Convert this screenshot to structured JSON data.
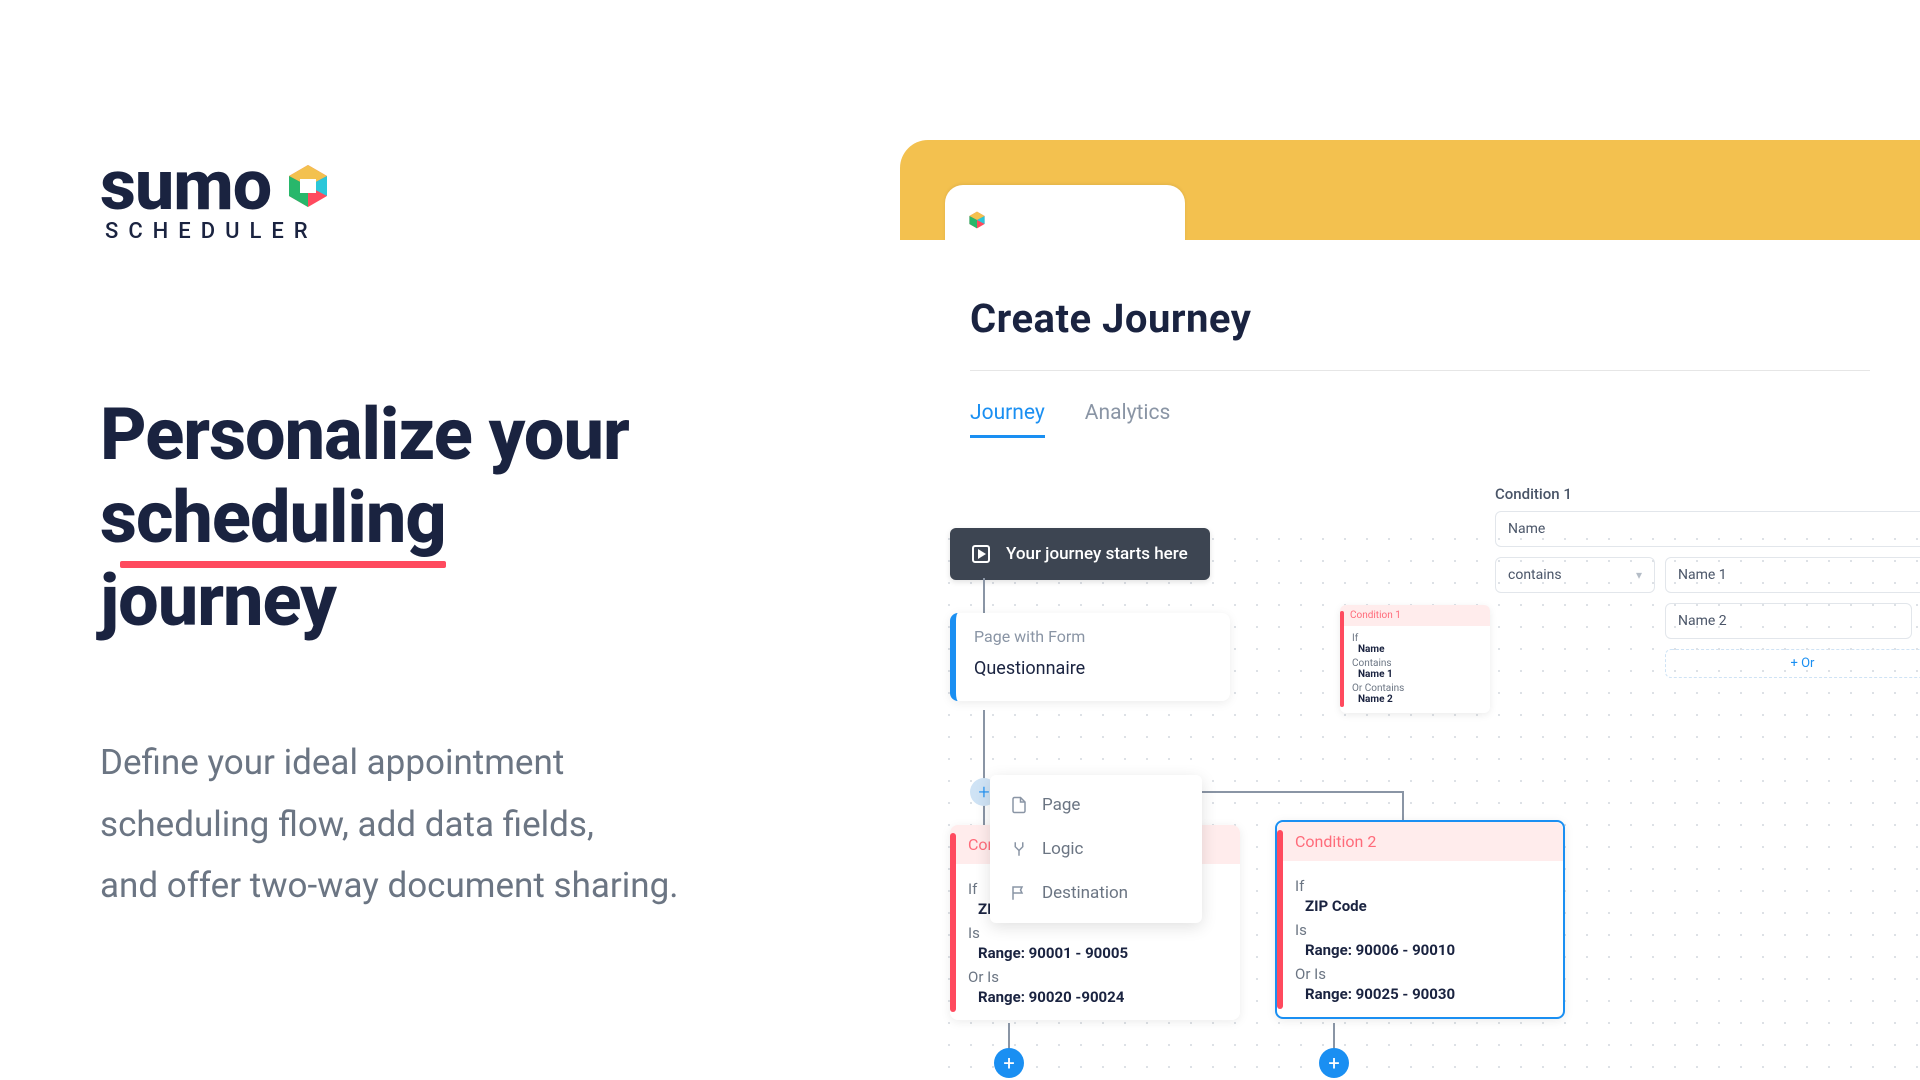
{
  "brand": {
    "name": "sumo",
    "sub": "SCHEDULER"
  },
  "headline": {
    "line1": "Personalize your",
    "underline": "scheduling",
    "line3": "journey"
  },
  "subtext": {
    "l1": "Define your ideal appointment",
    "l2": "scheduling flow, add data fields,",
    "l3": "and offer two-way document sharing."
  },
  "app": {
    "title": "Create Journey",
    "tabs": {
      "journey": "Journey",
      "analytics": "Analytics"
    },
    "start_label": "Your  journey starts here",
    "page_node": {
      "type": "Page with Form",
      "value": "Questionnaire"
    },
    "menu": {
      "page": "Page",
      "logic": "Logic",
      "destination": "Destination"
    },
    "cond1": {
      "title": "Condition 1",
      "if": "If",
      "if_val": "ZIP",
      "is": "Is",
      "is_val": "Range: 90001 - 90005",
      "oris": "Or Is",
      "or_val": "Range: 90020 -90024"
    },
    "cond2": {
      "title": "Condition 2",
      "if": "If",
      "if_val": "ZIP Code",
      "is": "Is",
      "is_val": "Range: 90006 - 90010",
      "oris": "Or Is",
      "or_val": "Range: 90025 - 90030"
    },
    "mini": {
      "title": "Condition 1",
      "if": "If",
      "if_val": "Name",
      "contains": "Contains",
      "contains_val": "Name 1",
      "orcontains": "Or Contains",
      "orcontains_val": "Name 2"
    },
    "editor": {
      "title": "Condition 1",
      "field": "Name",
      "op": "contains",
      "val1": "Name 1",
      "val2": "Name 2",
      "or_btn": "+  Or"
    }
  }
}
